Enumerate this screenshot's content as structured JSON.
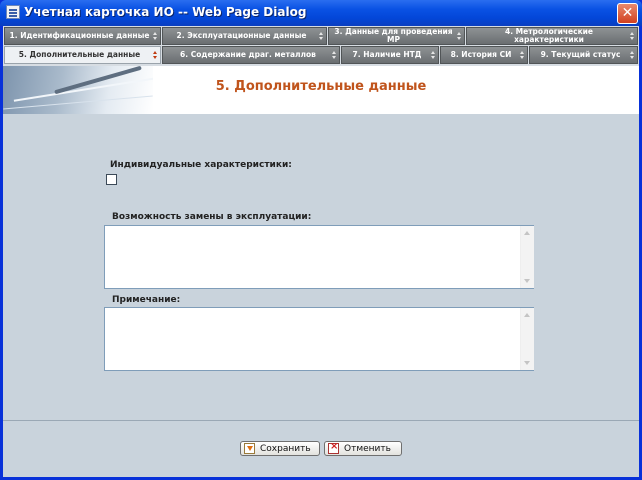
{
  "window": {
    "title": "Учетная карточка ИО -- Web Page Dialog",
    "close_glyph": "✕"
  },
  "tabs": [
    {
      "label": "1. Идентификационные данные",
      "active": false
    },
    {
      "label": "2. Эксплуатационные данные",
      "active": false
    },
    {
      "label": "3. Данные для проведения МР",
      "active": false
    },
    {
      "label": "4. Метрологические характеристики",
      "active": false
    },
    {
      "label": "5. Дополнительные данные",
      "active": true
    },
    {
      "label": "6. Содержание драг. металлов",
      "active": false
    },
    {
      "label": "7. Наличие НТД",
      "active": false
    },
    {
      "label": "8. История СИ",
      "active": false
    },
    {
      "label": "9. Текущий статус",
      "active": false
    }
  ],
  "page": {
    "title": "5. Дополнительные данные"
  },
  "form": {
    "individual_label": "Индивидуальные характеристики:",
    "individual_checked": false,
    "replacement_label": "Возможность замены в эксплуатации:",
    "replacement_value": "",
    "note_label": "Примечание:",
    "note_value": ""
  },
  "buttons": {
    "save": "Сохранить",
    "cancel": "Отменить"
  },
  "colors": {
    "title_bar": "#0a52e4",
    "page_title": "#c0541c",
    "tab_bg": "#7c8083",
    "content_bg": "#c9d3dc"
  },
  "icons": {
    "app": "dialog-icon",
    "close": "close-icon",
    "save": "save-icon",
    "cancel": "cancel-icon"
  }
}
